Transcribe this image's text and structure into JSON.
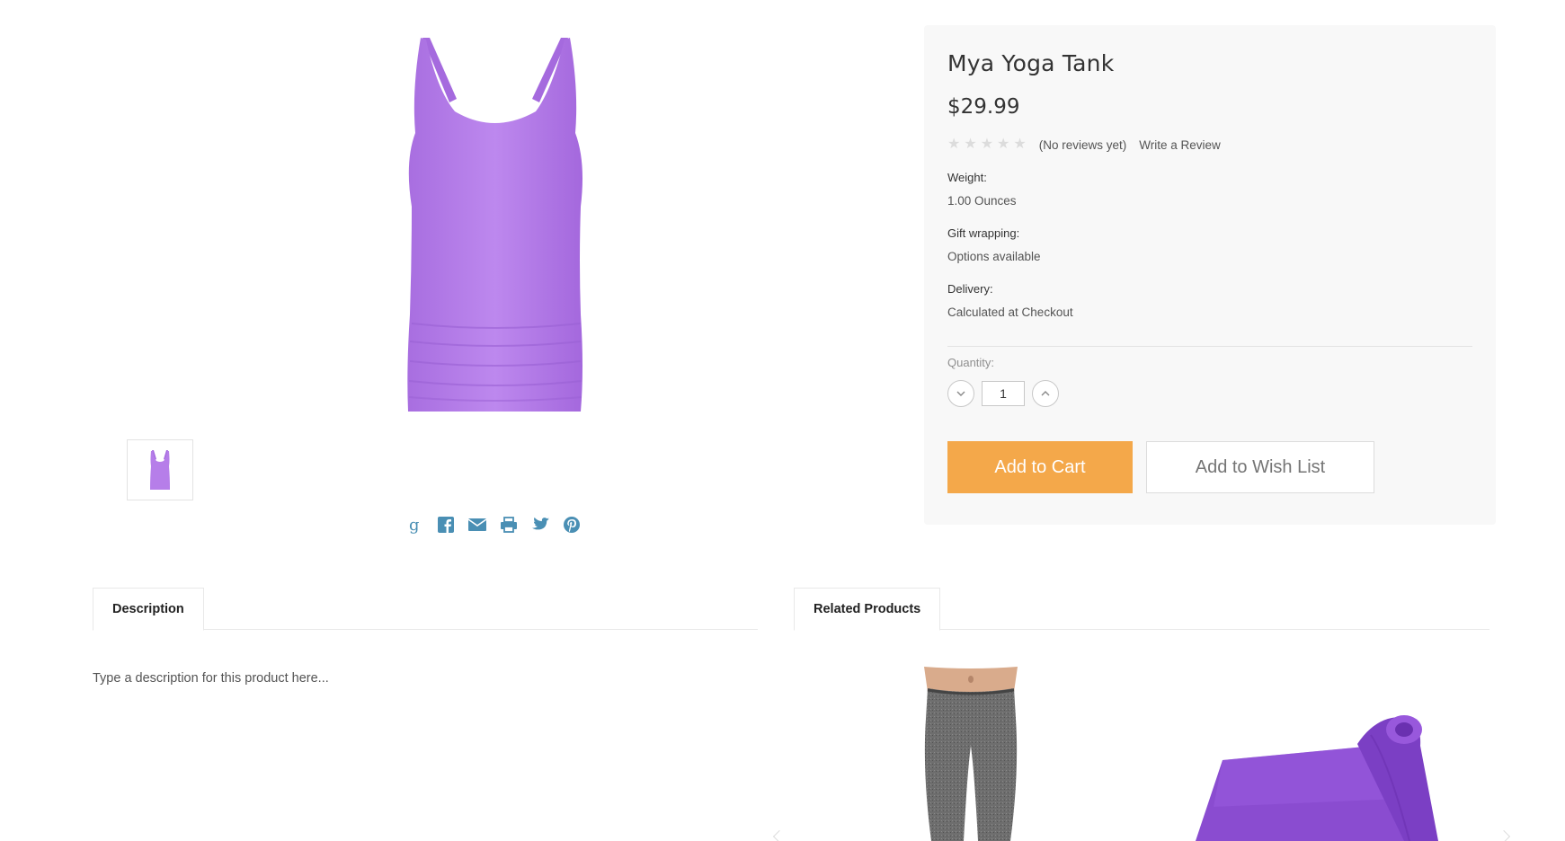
{
  "product": {
    "title": "Mya Yoga Tank",
    "price": "$29.99",
    "rating": {
      "stars_filled": 0,
      "stars_total": 5,
      "reviews_text": "(No reviews yet)",
      "write_review": "Write a Review"
    },
    "specs": [
      {
        "label": "Weight:",
        "value": "1.00 Ounces"
      },
      {
        "label": "Gift wrapping:",
        "value": "Options available"
      },
      {
        "label": "Delivery:",
        "value": "Calculated at Checkout"
      }
    ],
    "quantity": {
      "label": "Quantity:",
      "value": "1"
    },
    "buttons": {
      "add_to_cart": "Add to Cart",
      "add_to_wishlist": "Add to Wish List"
    }
  },
  "share_icons": [
    "google-plus-icon",
    "facebook-icon",
    "email-icon",
    "print-icon",
    "twitter-icon",
    "pinterest-icon"
  ],
  "tabs": {
    "description": {
      "label": "Description",
      "text": "Type a description for this product here..."
    },
    "related": {
      "label": "Related Products"
    }
  },
  "colors": {
    "accent_orange": "#f4a84a",
    "share_icon_blue": "#4a8fb4",
    "product_purple": "#b67ee9",
    "panel_bg": "#f8f8f8"
  }
}
